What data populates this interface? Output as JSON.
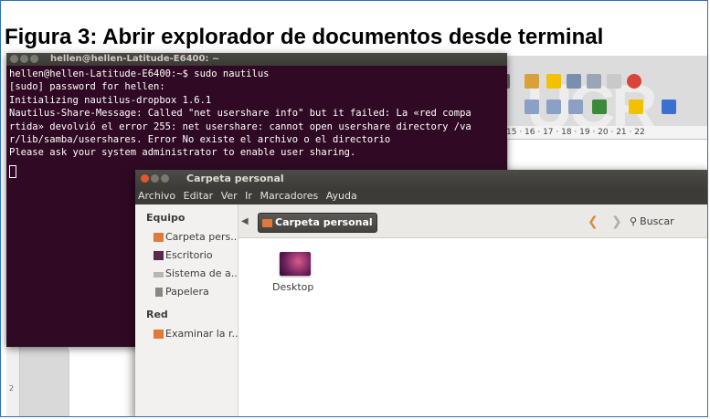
{
  "caption": "Figura 3: Abrir explorador de documentos desde terminal",
  "background_app": {
    "ruler_text": "15 · 16 · 17 · 18 · 19 · 20 · 21 · 22",
    "left_ruler_mark": "2"
  },
  "terminal": {
    "title": "hellen@hellen-Latitude-E6400: ~",
    "lines": [
      "hellen@hellen-Latitude-E6400:~$ sudo nautilus",
      "[sudo] password for hellen:",
      "Initializing nautilus-dropbox 1.6.1",
      "Nautilus-Share-Message: Called \"net usershare info\" but it failed: La «red compa",
      "rtida» devolvió el error 255: net usershare: cannot open usershare directory /va",
      "r/lib/samba/usershares. Error No existe el archivo o el directorio",
      "Please ask your system administrator to enable user sharing."
    ]
  },
  "file_manager": {
    "title": "Carpeta personal",
    "menu": [
      "Archivo",
      "Editar",
      "Ver",
      "Ir",
      "Marcadores",
      "Ayuda"
    ],
    "sidebar": {
      "sections": [
        {
          "header": "Equipo",
          "items": [
            {
              "label": "Carpeta pers...",
              "icon": "home-folder-icon"
            },
            {
              "label": "Escritorio",
              "icon": "desktop-icon"
            },
            {
              "label": "Sistema de a...",
              "icon": "drive-icon"
            },
            {
              "label": "Papelera",
              "icon": "trash-icon"
            }
          ]
        },
        {
          "header": "Red",
          "items": [
            {
              "label": "Examinar la r...",
              "icon": "network-icon"
            }
          ]
        }
      ]
    },
    "location": "Carpeta personal",
    "search_label": "Buscar",
    "files": [
      {
        "label": "Desktop",
        "icon": "desktop-folder-icon"
      }
    ]
  }
}
